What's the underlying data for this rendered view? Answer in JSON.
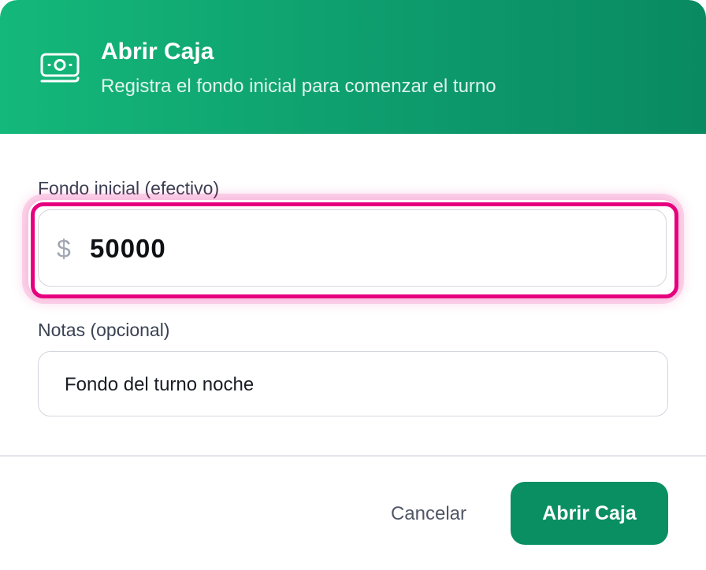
{
  "dialog": {
    "title": "Abrir Caja",
    "subtitle": "Registra el fondo inicial para comenzar el turno",
    "header_icon": "cash-icon"
  },
  "fields": {
    "fondo": {
      "label": "Fondo inicial (efectivo)",
      "currency": "$",
      "value": "50000"
    },
    "notas": {
      "label": "Notas (opcional)",
      "value": "Fondo del turno noche"
    }
  },
  "footer": {
    "cancel_label": "Cancelar",
    "submit_label": "Abrir Caja"
  },
  "colors": {
    "header_start": "#14b87a",
    "header_end": "#0a8a61",
    "focus_ring": "#e6007e",
    "primary_button": "#0a8f63"
  }
}
